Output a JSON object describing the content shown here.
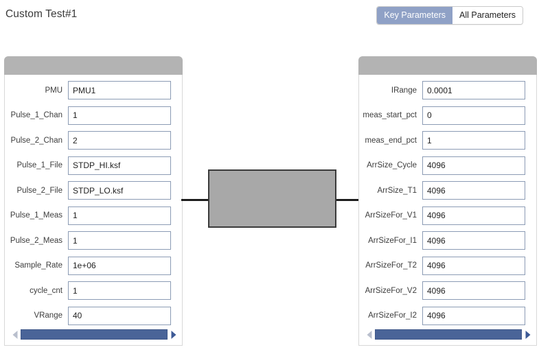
{
  "header": {
    "title": "Custom Test#1",
    "toggle": {
      "options": [
        "Key Parameters",
        "All Parameters"
      ],
      "selected": "Key Parameters",
      "selected_color": "#8fa1c6"
    }
  },
  "left_panel": {
    "rows": [
      {
        "label": "PMU",
        "value": "PMU1"
      },
      {
        "label": "Pulse_1_Chan",
        "value": "1"
      },
      {
        "label": "Pulse_2_Chan",
        "value": "2"
      },
      {
        "label": "Pulse_1_File",
        "value": "STDP_HI.ksf"
      },
      {
        "label": "Pulse_2_File",
        "value": "STDP_LO.ksf"
      },
      {
        "label": "Pulse_1_Meas",
        "value": "1"
      },
      {
        "label": "Pulse_2_Meas",
        "value": "1"
      },
      {
        "label": "Sample_Rate",
        "value": "1e+06"
      },
      {
        "label": "cycle_cnt",
        "value": "1"
      },
      {
        "label": "VRange",
        "value": "40"
      }
    ],
    "scrollbar": {
      "left_arrow": "scroll-left-arrow",
      "right_arrow": "scroll-right-arrow",
      "thumb_color": "#4a6498"
    }
  },
  "right_panel": {
    "rows": [
      {
        "label": "IRange",
        "value": "0.0001"
      },
      {
        "label": "meas_start_pct",
        "value": "0"
      },
      {
        "label": "meas_end_pct",
        "value": "1"
      },
      {
        "label": "ArrSize_Cycle",
        "value": "4096"
      },
      {
        "label": "ArrSize_T1",
        "value": "4096"
      },
      {
        "label": "ArrSizeFor_V1",
        "value": "4096"
      },
      {
        "label": "ArrSizeFor_I1",
        "value": "4096"
      },
      {
        "label": "ArrSizeFor_T2",
        "value": "4096"
      },
      {
        "label": "ArrSizeFor_V2",
        "value": "4096"
      },
      {
        "label": "ArrSizeFor_I2",
        "value": "4096"
      }
    ],
    "scrollbar": {
      "left_arrow": "scroll-left-arrow",
      "right_arrow": "scroll-right-arrow",
      "thumb_color": "#4a6498"
    }
  },
  "device_diagram": {
    "box_fill": "#a8a8a8",
    "box_stroke": "#3a3a3a",
    "wire_color": "#1d1d1d"
  }
}
